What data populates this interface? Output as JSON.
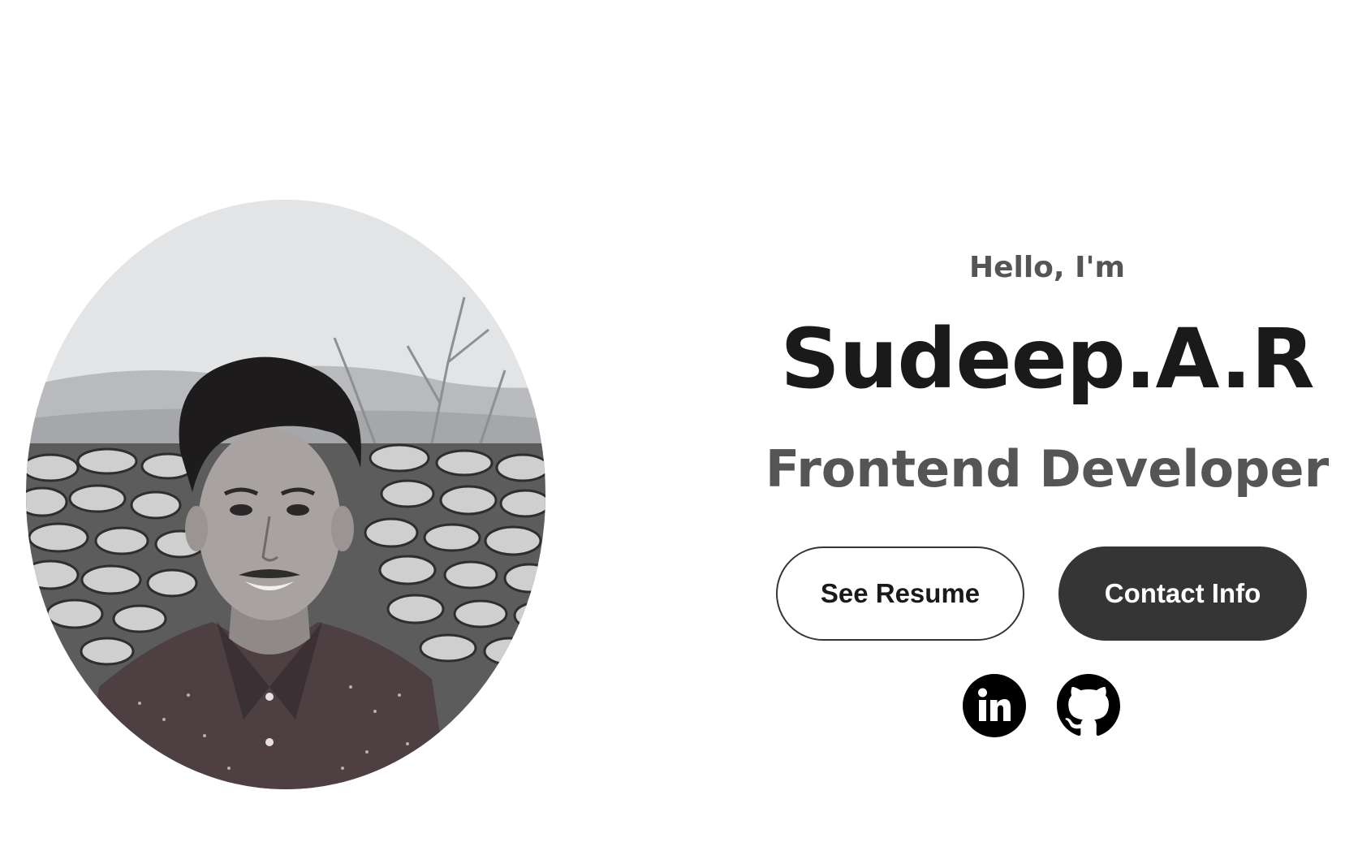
{
  "profile": {
    "image_alt": "profile picture"
  },
  "hero": {
    "greeting": "Hello, I'm",
    "name": "Sudeep.A.R",
    "role": "Frontend Developer"
  },
  "buttons": {
    "resume_label": "See Resume",
    "contact_label": "Contact Info"
  },
  "socials": [
    {
      "name": "LinkedIn",
      "icon": "linkedin-icon"
    },
    {
      "name": "GitHub",
      "icon": "github-icon"
    }
  ],
  "colors": {
    "background": "#ffffff",
    "text_dark": "#1a1a1a",
    "text_muted": "#555555",
    "button_dark": "#353535"
  }
}
